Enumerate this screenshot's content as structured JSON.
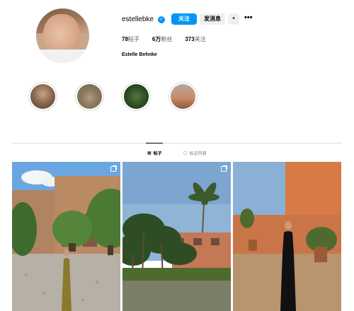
{
  "profile": {
    "username": "estellebke",
    "verified_icon": "verified-badge-icon",
    "full_name": "Estelle Behnke",
    "follow_label": "关注",
    "message_label": "发消息",
    "suggest_label": "+",
    "more_label": "•••"
  },
  "stats": {
    "posts_count": "78",
    "posts_label": "帖子",
    "followers_count": "6万",
    "followers_label": "粉丝",
    "following_count": "373",
    "following_label": "关注"
  },
  "highlights": [
    {
      "name": "highlight-1"
    },
    {
      "name": "highlight-2"
    },
    {
      "name": "highlight-3"
    },
    {
      "name": "highlight-4"
    }
  ],
  "tabs": {
    "posts_label": "帖子",
    "tagged_label": "标记内容"
  },
  "posts": [
    {
      "name": "post-1",
      "multi": true
    },
    {
      "name": "post-2",
      "multi": true
    },
    {
      "name": "post-3",
      "multi": false
    }
  ],
  "colors": {
    "accent": "#0095f6",
    "secondary_button": "#efefef",
    "border": "#dbdbdb"
  }
}
